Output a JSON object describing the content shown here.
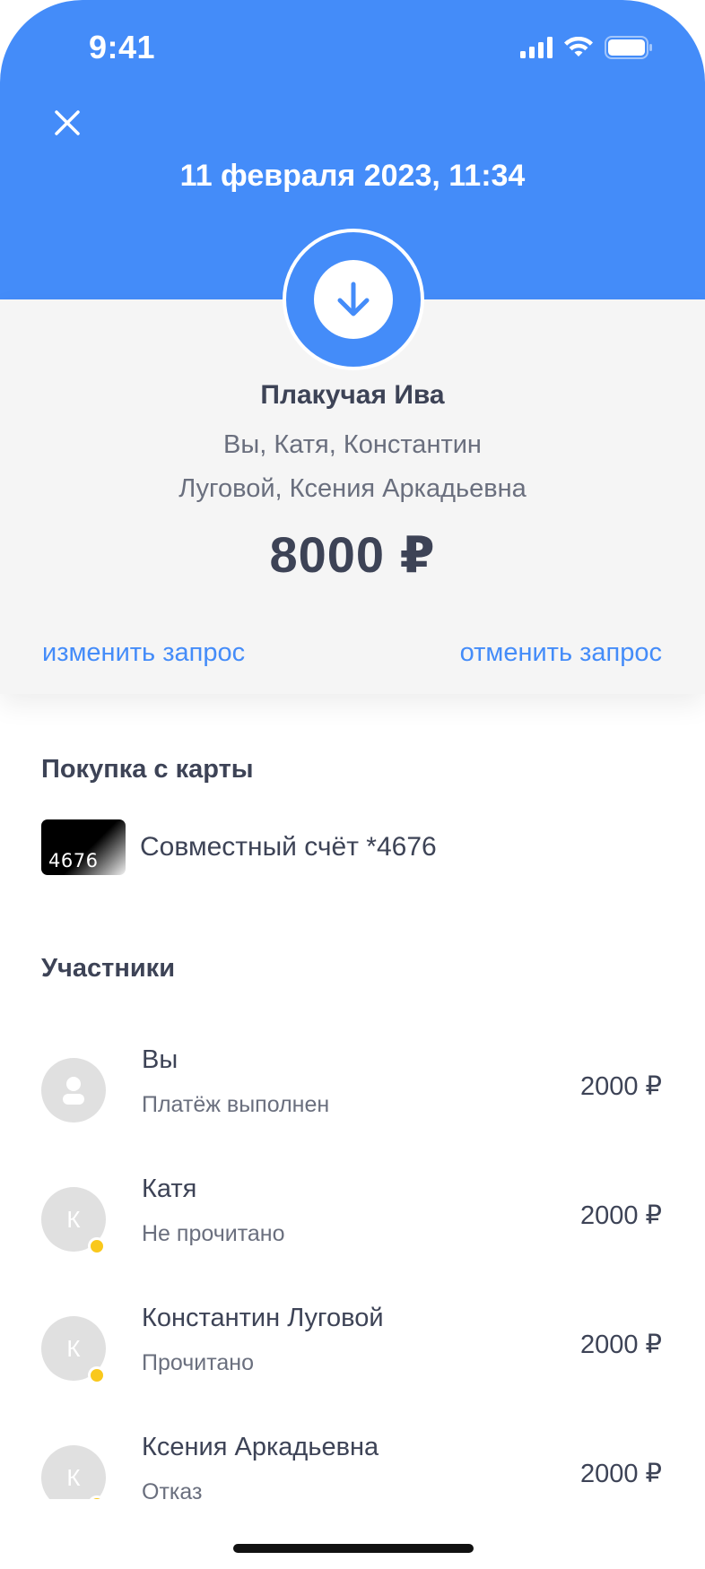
{
  "status_bar": {
    "time": "9:41"
  },
  "header": {
    "date": "11 февраля 2023, 11:34"
  },
  "group": {
    "name": "Плакучая Ива",
    "members_line1": "Вы, Катя, Константин",
    "members_line2": "Луговой, Ксения Аркадьевна",
    "total": "8000 ₽"
  },
  "actions": {
    "edit": "изменить запрос",
    "cancel": "отменить запрос"
  },
  "purchase": {
    "section_title": "Покупка с карты",
    "card_number": "4676",
    "account_label": "Совместный счёт *4676"
  },
  "participants_section": {
    "title": "Участники"
  },
  "participants": [
    {
      "name": "Вы",
      "status": "Платёж выполнен",
      "amount": "2000 ₽",
      "initial": ""
    },
    {
      "name": "Катя",
      "status": "Не прочитано",
      "amount": "2000 ₽",
      "initial": "К"
    },
    {
      "name": "Константин Луговой",
      "status": "Прочитано",
      "amount": "2000 ₽",
      "initial": "К"
    },
    {
      "name": "Ксения Аркадьевна",
      "status": "Отказ",
      "amount": "2000 ₽",
      "initial": "К"
    }
  ],
  "colors": {
    "accent": "#448cf9",
    "text": "#3d4356",
    "muted": "#6a6f7e",
    "pending_dot": "#f9c81c"
  }
}
